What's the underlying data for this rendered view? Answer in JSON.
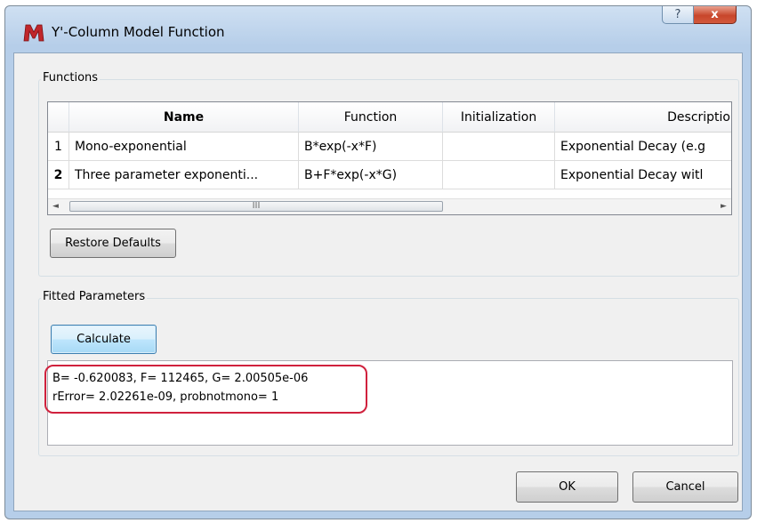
{
  "window": {
    "title": "Y'-Column Model Function",
    "help_glyph": "?",
    "close_glyph": "x"
  },
  "functions_group": {
    "title": "Functions",
    "table": {
      "columns": [
        "Name",
        "Function",
        "Initialization",
        "Descriptio"
      ],
      "rows": [
        {
          "num": "1",
          "name": "Mono-exponential",
          "function": "B*exp(-x*F)",
          "initialization": "",
          "description": "Exponential Decay (e.g"
        },
        {
          "num": "2",
          "name": "Three parameter exponenti...",
          "function": "B+F*exp(-x*G)",
          "initialization": "",
          "description": "Exponential Decay witl"
        }
      ],
      "scroll_thumb_grip": "III",
      "scroll_left_arrow": "◄",
      "scroll_right_arrow": "►"
    },
    "restore_label": "Restore Defaults"
  },
  "fitted_group": {
    "title": "Fitted Parameters",
    "calculate_label": "Calculate",
    "output_lines": [
      "B= -0.620083, F= 112465, G= 2.00505e-06",
      "rError= 2.02261e-09, probnotmono= 1"
    ]
  },
  "footer": {
    "ok_label": "OK",
    "cancel_label": "Cancel"
  },
  "colors": {
    "annotation": "#d0213d",
    "title_bar": "#b6cee9",
    "close_button": "#c8462b"
  },
  "icons": {
    "app": "app-logo-icon"
  }
}
